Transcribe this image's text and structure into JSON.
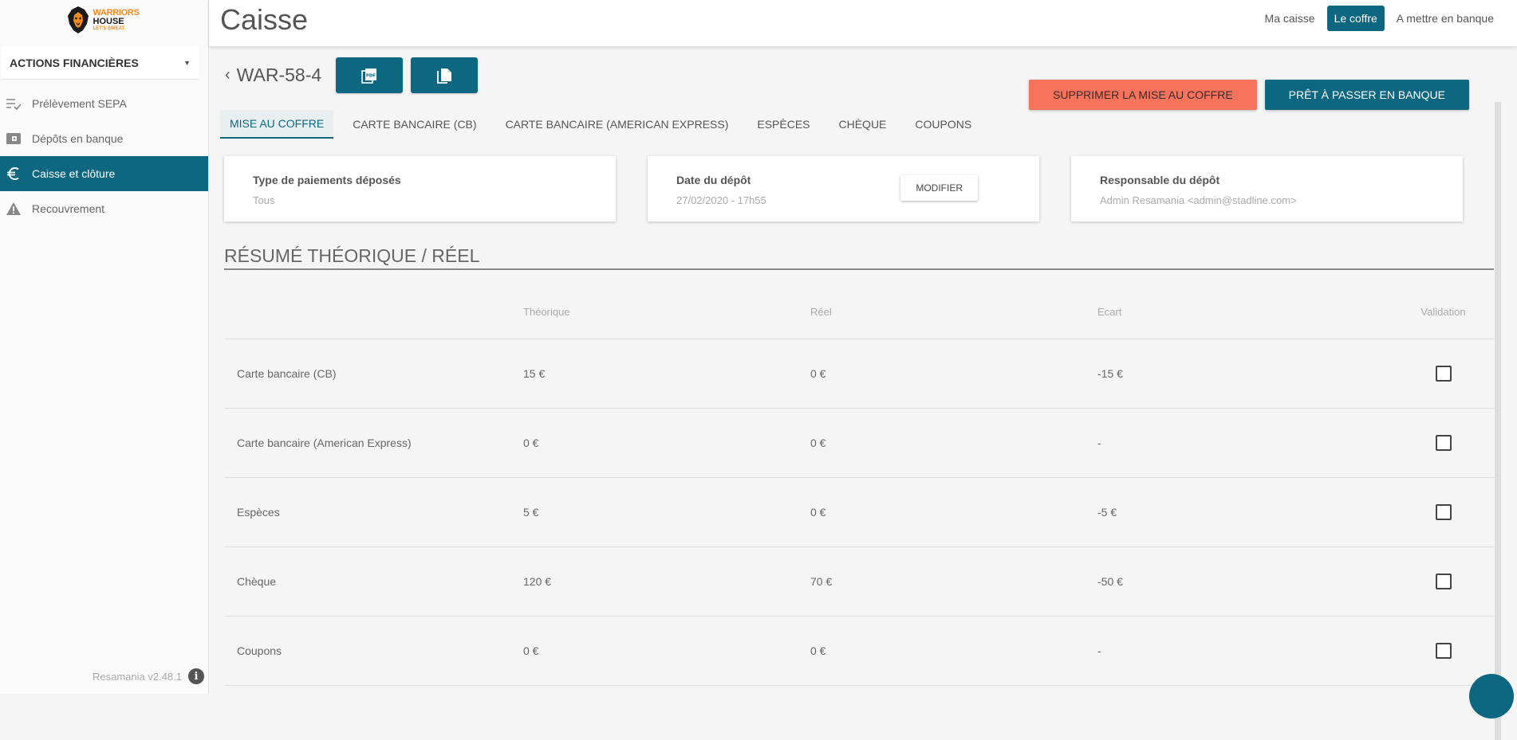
{
  "brand": {
    "logo_alt": "Warriors House",
    "line1": "WARRIORS",
    "line2": "HOUSE",
    "line3": "LET'S SWEAT."
  },
  "sidebar": {
    "section_label": "ACTIONS FINANCIÈRES",
    "items": [
      {
        "label": "Prélèvement SEPA",
        "icon": "checklist-icon",
        "active": false
      },
      {
        "label": "Dépôts en banque",
        "icon": "wallet-icon",
        "active": false
      },
      {
        "label": "Caisse et clôture",
        "icon": "euro-icon",
        "active": true
      },
      {
        "label": "Recouvrement",
        "icon": "warning-icon",
        "active": false
      }
    ],
    "version": "Resamania v2.48.1"
  },
  "header": {
    "title": "Caisse",
    "links": [
      {
        "label": "Ma caisse",
        "active": false
      },
      {
        "label": "Le coffre",
        "active": true
      },
      {
        "label": "A mettre en banque",
        "active": false
      }
    ]
  },
  "detail": {
    "reference": "WAR-58-4",
    "delete_label": "SUPPRIMER LA MISE AU COFFRE",
    "bank_label": "PRÊT À PASSER EN BANQUE",
    "tabs": [
      {
        "label": "MISE AU COFFRE",
        "active": true
      },
      {
        "label": "CARTE BANCAIRE (CB)",
        "active": false
      },
      {
        "label": "CARTE BANCAIRE (AMERICAN EXPRESS)",
        "active": false
      },
      {
        "label": "ESPÈCES",
        "active": false
      },
      {
        "label": "CHÈQUE",
        "active": false
      },
      {
        "label": "COUPONS",
        "active": false
      }
    ],
    "cards": {
      "type": {
        "label": "Type de paiements déposés",
        "value": "Tous"
      },
      "date": {
        "label": "Date du dépôt",
        "value": "27/02/2020 - 17h55",
        "button": "MODIFIER"
      },
      "owner": {
        "label": "Responsable du dépôt",
        "value": "Admin Resamania <admin@stadline.com>"
      }
    }
  },
  "summary": {
    "title": "RÉSUMÉ THÉORIQUE / RÉEL",
    "columns": [
      "",
      "Théorique",
      "Réel",
      "Ecart",
      "Validation"
    ],
    "rows": [
      {
        "label": "Carte bancaire (CB)",
        "theorique": "15 €",
        "reel": "0 €",
        "ecart": "-15 €",
        "validated": false
      },
      {
        "label": "Carte bancaire (American Express)",
        "theorique": "0 €",
        "reel": "0 €",
        "ecart": "-",
        "validated": false
      },
      {
        "label": "Espèces",
        "theorique": "5 €",
        "reel": "0 €",
        "ecart": "-5 €",
        "validated": false
      },
      {
        "label": "Chèque",
        "theorique": "120 €",
        "reel": "70 €",
        "ecart": "-50 €",
        "validated": false
      },
      {
        "label": "Coupons",
        "theorique": "0 €",
        "reel": "0 €",
        "ecart": "-",
        "validated": false
      }
    ]
  },
  "colors": {
    "primary": "#0d6780",
    "danger": "#f8735b"
  }
}
